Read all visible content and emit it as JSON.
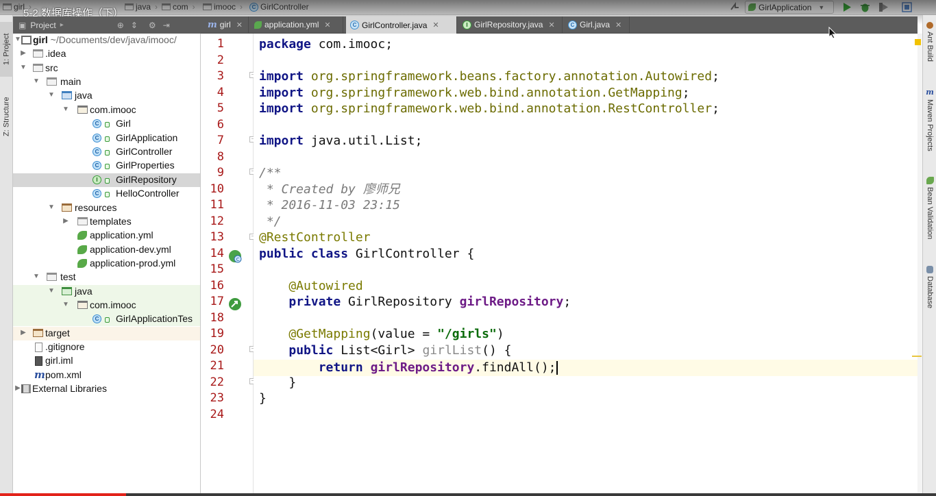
{
  "video": {
    "title": "5-2 数据库操作（下）",
    "progress": 0.135
  },
  "navbar": {
    "crumbs": [
      "girl",
      "java",
      "com",
      "imooc",
      "GirlController"
    ],
    "run_config": "GirlApplication"
  },
  "left_stripe": {
    "tabs": [
      "1: Project",
      "Z: Structure"
    ]
  },
  "project_panel": {
    "header": "Project"
  },
  "tree": {
    "root_name": "girl",
    "root_path": "~/Documents/dev/java/imooc/",
    "items": [
      "girl",
      ".idea",
      "src",
      "main",
      "java",
      "com.imooc",
      "Girl",
      "GirlApplication",
      "GirlController",
      "GirlProperties",
      "GirlRepository",
      "HelloController",
      "resources",
      "templates",
      "application.yml",
      "application-dev.yml",
      "application-prod.yml",
      "test",
      "java",
      "com.imooc",
      "GirlApplicationTes",
      "target",
      ".gitignore",
      "girl.iml",
      "pom.xml",
      "External Libraries"
    ]
  },
  "editor_tabs": [
    {
      "label": "girl",
      "icon": "maven-icon"
    },
    {
      "label": "application.yml",
      "icon": "spring-icon"
    },
    {
      "label": "GirlController.java",
      "icon": "class-icon",
      "active": true
    },
    {
      "label": "GirlRepository.java",
      "icon": "interface-icon"
    },
    {
      "label": "Girl.java",
      "icon": "class-icon"
    }
  ],
  "editor": {
    "line_numbers": [
      "1",
      "2",
      "3",
      "4",
      "5",
      "6",
      "7",
      "8",
      "9",
      "10",
      "11",
      "12",
      "13",
      "14",
      "15",
      "16",
      "17",
      "18",
      "19",
      "20",
      "21",
      "22",
      "23",
      "24"
    ],
    "code": {
      "l1_kw": "package",
      "l1_rest": " com.imooc;",
      "l3_kw": "import",
      "l3_rest": " org.springframework.beans.factory.annotation.Autowired",
      "l4_kw": "import",
      "l4_rest": " org.springframework.web.bind.annotation.GetMapping",
      "l5_kw": "import",
      "l5_rest": " org.springframework.web.bind.annotation.RestController",
      "semicolon": ";",
      "l7_kw": "import",
      "l7_rest": " java.util.List;",
      "l9": "/**",
      "l10": " * Created by 廖师兄",
      "l11": " * 2016-11-03 23:15",
      "l12": " */",
      "l13": "@RestController",
      "l14_kw": "public class",
      "l14_rest": " GirlController {",
      "l16": "    @Autowired",
      "l17_indent": "    ",
      "l17_kw": "private",
      "l17_type": " GirlRepository ",
      "l17_field": "girlRepository",
      "l17_end": ";",
      "l19_indent": "    ",
      "l19_ann": "@GetMapping",
      "l19_a": "(value = ",
      "l19_str": "\"/girls\"",
      "l19_b": ")",
      "l20_indent": "    ",
      "l20_kw": "public",
      "l20_type": " List<Girl> ",
      "l20_method": "girlList",
      "l20_end": "() {",
      "l21_indent": "        ",
      "l21_kw": "return",
      "l21_sp": " ",
      "l21_field": "girlRepository",
      "l21_end": ".findAll();",
      "l22": "    }",
      "l23": "}"
    }
  },
  "right_stripe": {
    "tabs": [
      "Ant Build",
      "Maven Projects",
      "Bean Validation",
      "Database"
    ]
  },
  "colors": {
    "keyword": "#101585",
    "annotation": "#7a7a00",
    "field": "#6d1b86",
    "string": "#0b6b0b",
    "line_number": "#a81818",
    "current_line": "#fffbe6"
  }
}
